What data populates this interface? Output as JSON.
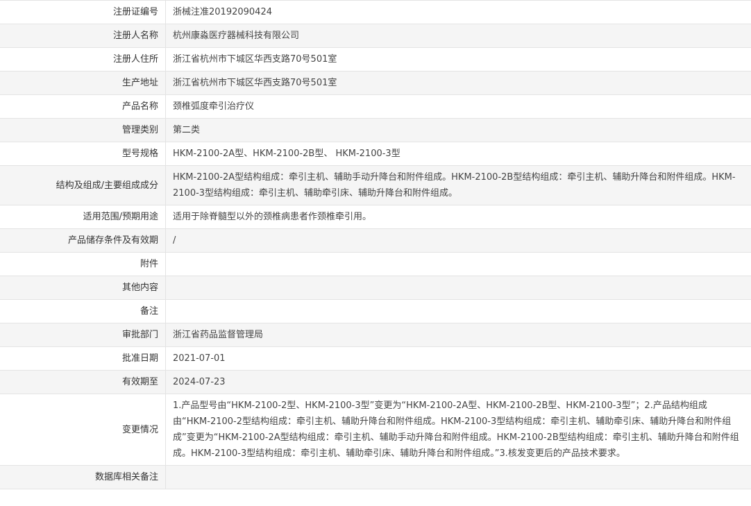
{
  "rows": [
    {
      "label": "注册证编号",
      "value": "浙械注准20192090424"
    },
    {
      "label": "注册人名称",
      "value": "杭州康淼医疗器械科技有限公司"
    },
    {
      "label": "注册人住所",
      "value": "浙江省杭州市下城区华西支路70号501室"
    },
    {
      "label": "生产地址",
      "value": "浙江省杭州市下城区华西支路70号501室"
    },
    {
      "label": "产品名称",
      "value": "颈椎弧度牵引治疗仪"
    },
    {
      "label": "管理类别",
      "value": "第二类"
    },
    {
      "label": "型号规格",
      "value": "HKM-2100-2A型、HKM-2100-2B型、 HKM-2100-3型"
    },
    {
      "label": "结构及组成/主要组成成分",
      "value": "HKM-2100-2A型结构组成：牵引主机、辅助手动升降台和附件组成。HKM-2100-2B型结构组成：牵引主机、辅助升降台和附件组成。HKM-2100-3型结构组成：牵引主机、辅助牵引床、辅助升降台和附件组成。"
    },
    {
      "label": "适用范围/预期用途",
      "value": "适用于除脊髓型以外的颈椎病患者作颈椎牵引用。"
    },
    {
      "label": "产品储存条件及有效期",
      "value": "/"
    },
    {
      "label": "附件",
      "value": ""
    },
    {
      "label": "其他内容",
      "value": ""
    },
    {
      "label": "备注",
      "value": ""
    },
    {
      "label": "审批部门",
      "value": "浙江省药品监督管理局"
    },
    {
      "label": "批准日期",
      "value": "2021-07-01"
    },
    {
      "label": "有效期至",
      "value": "2024-07-23"
    },
    {
      "label": "变更情况",
      "value": "1.产品型号由“HKM-2100-2型、HKM-2100-3型”变更为“HKM-2100-2A型、HKM-2100-2B型、HKM-2100-3型”；2.产品结构组成由“HKM-2100-2型结构组成：牵引主机、辅助升降台和附件组成。HKM-2100-3型结构组成：牵引主机、辅助牵引床、辅助升降台和附件组成”变更为“HKM-2100-2A型结构组成：牵引主机、辅助手动升降台和附件组成。HKM-2100-2B型结构组成：牵引主机、辅助升降台和附件组成。HKM-2100-3型结构组成：牵引主机、辅助牵引床、辅助升降台和附件组成。”3.核发变更后的产品技术要求。"
    },
    {
      "label": "数据库相关备注",
      "value": ""
    }
  ]
}
